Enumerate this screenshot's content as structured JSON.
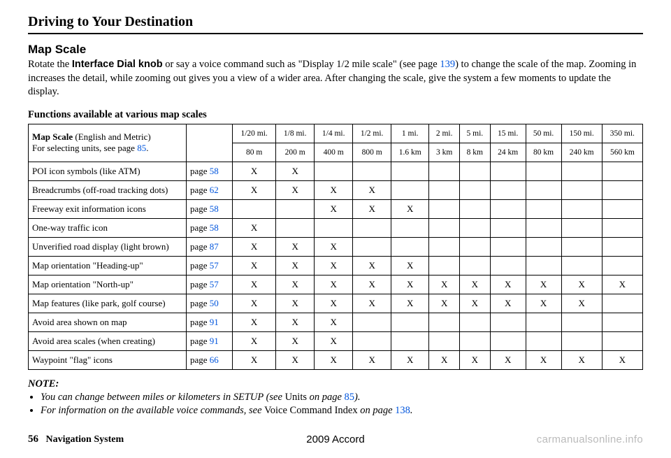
{
  "chapter_title": "Driving to Your Destination",
  "section_title": "Map Scale",
  "intro": {
    "pre_bold": "Rotate the ",
    "bold": "Interface Dial knob",
    "post_bold_1": " or say a voice command such as \"Display 1/2 mile scale\" (see page ",
    "link1": "139",
    "post_bold_2": ") to change the scale of the map. Zooming in increases the detail, while zooming out gives you a view of a wider area. After changing the scale, give the system a few moments to update the display."
  },
  "table_title": "Functions available at various map scales",
  "table": {
    "head_label_line1": "Map Scale",
    "head_label_line1_suffix": " (English and Metric)",
    "head_label_line2_pre": "For selecting units, see page ",
    "head_label_line2_link": "85",
    "head_label_line2_post": ".",
    "page_prefix": "page ",
    "scales_imperial": [
      "1/20 mi.",
      "1/8 mi.",
      "1/4 mi.",
      "1/2 mi.",
      "1 mi.",
      "2 mi.",
      "5 mi.",
      "15 mi.",
      "50 mi.",
      "150 mi.",
      "350 mi."
    ],
    "scales_metric": [
      "80 m",
      "200 m",
      "400 m",
      "800 m",
      "1.6 km",
      "3 km",
      "8 km",
      "24 km",
      "80 km",
      "240 km",
      "560 km"
    ],
    "rows": [
      {
        "label": "POI icon symbols (like ATM)",
        "page": "58",
        "marks": [
          "X",
          "X",
          "",
          "",
          "",
          "",
          "",
          "",
          "",
          "",
          ""
        ]
      },
      {
        "label": "Breadcrumbs (off-road tracking dots)",
        "page": "62",
        "marks": [
          "X",
          "X",
          "X",
          "X",
          "",
          "",
          "",
          "",
          "",
          "",
          ""
        ]
      },
      {
        "label": "Freeway exit information icons",
        "page": "58",
        "marks": [
          "",
          "",
          "X",
          "X",
          "X",
          "",
          "",
          "",
          "",
          "",
          ""
        ]
      },
      {
        "label": "One-way traffic icon",
        "page": "58",
        "marks": [
          "X",
          "",
          "",
          "",
          "",
          "",
          "",
          "",
          "",
          "",
          ""
        ]
      },
      {
        "label": "Unverified road display (light brown)",
        "page": "87",
        "marks": [
          "X",
          "X",
          "X",
          "",
          "",
          "",
          "",
          "",
          "",
          "",
          ""
        ]
      },
      {
        "label": "Map orientation \"Heading-up\"",
        "page": "57",
        "marks": [
          "X",
          "X",
          "X",
          "X",
          "X",
          "",
          "",
          "",
          "",
          "",
          ""
        ]
      },
      {
        "label": "Map orientation \"North-up\"",
        "page": "57",
        "marks": [
          "X",
          "X",
          "X",
          "X",
          "X",
          "X",
          "X",
          "X",
          "X",
          "X",
          "X"
        ]
      },
      {
        "label": "Map features (like park, golf course)",
        "page": "50",
        "marks": [
          "X",
          "X",
          "X",
          "X",
          "X",
          "X",
          "X",
          "X",
          "X",
          "X",
          ""
        ]
      },
      {
        "label": "Avoid area shown on map",
        "page": "91",
        "marks": [
          "X",
          "X",
          "X",
          "",
          "",
          "",
          "",
          "",
          "",
          "",
          ""
        ]
      },
      {
        "label": "Avoid area scales (when creating)",
        "page": "91",
        "marks": [
          "X",
          "X",
          "X",
          "",
          "",
          "",
          "",
          "",
          "",
          "",
          ""
        ]
      },
      {
        "label": "Waypoint \"flag\" icons",
        "page": "66",
        "marks": [
          "X",
          "X",
          "X",
          "X",
          "X",
          "X",
          "X",
          "X",
          "X",
          "X",
          "X"
        ]
      }
    ]
  },
  "notes": {
    "label": "NOTE:",
    "items": [
      {
        "pre": "You can change between miles or kilometers in SETUP (see ",
        "roman": "Units",
        "mid": " on page ",
        "link": "85",
        "post": ")."
      },
      {
        "pre": "For information on the available voice commands, see ",
        "roman": "Voice Command Index",
        "mid": " on page ",
        "link": "138",
        "post": "."
      }
    ]
  },
  "footer": {
    "page_number": "56",
    "system_label": "Navigation System",
    "model": "2009  Accord",
    "watermark": "carmanualsonline.info"
  }
}
